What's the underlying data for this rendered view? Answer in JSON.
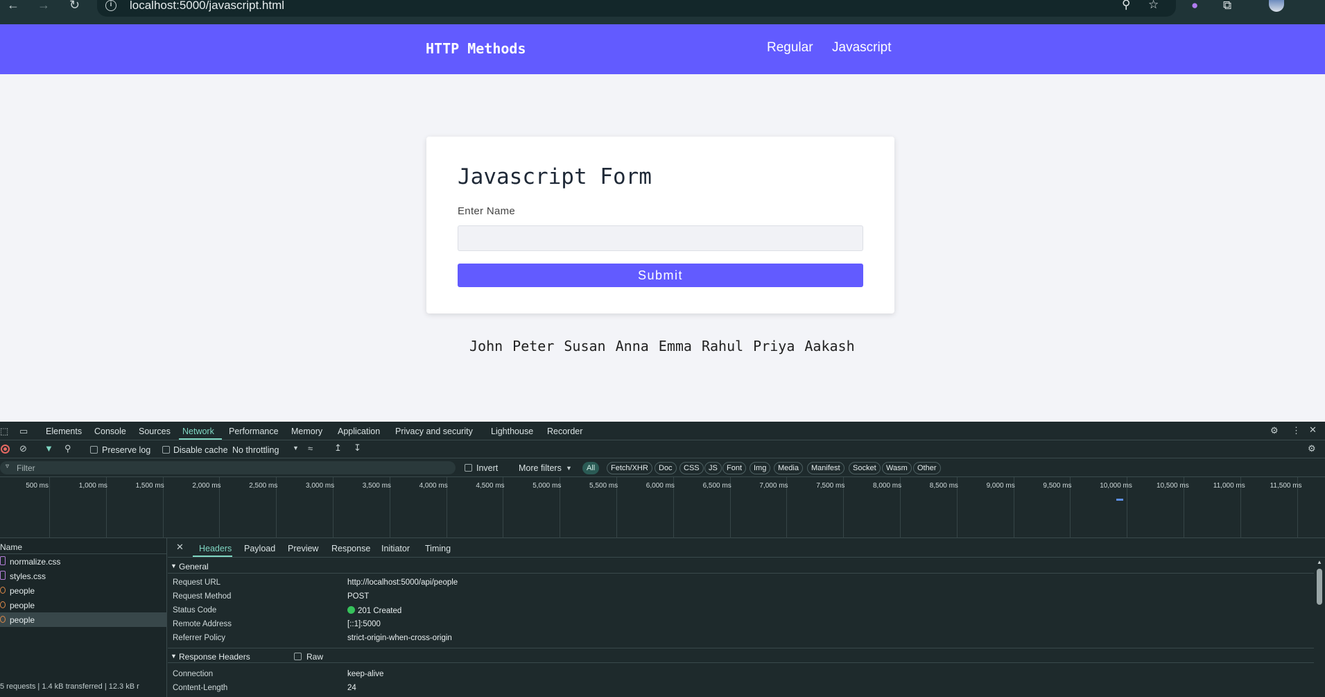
{
  "browser": {
    "url": "localhost:5000/javascript.html"
  },
  "header": {
    "brand": "HTTP Methods",
    "nav": [
      "Regular",
      "Javascript"
    ]
  },
  "form": {
    "title": "Javascript Form",
    "label": "Enter Name",
    "input_value": "",
    "submit_label": "Submit"
  },
  "names": [
    "John",
    "Peter",
    "Susan",
    "Anna",
    "Emma",
    "Rahul",
    "Priya",
    "Aakash"
  ],
  "devtools": {
    "tabs": [
      "Elements",
      "Console",
      "Sources",
      "Network",
      "Performance",
      "Memory",
      "Application",
      "Privacy and security",
      "Lighthouse",
      "Recorder"
    ],
    "active_tab": "Network",
    "toolbar": {
      "preserve_log": "Preserve log",
      "disable_cache": "Disable cache",
      "throttling": "No throttling"
    },
    "filter": {
      "placeholder": "Filter",
      "invert": "Invert",
      "more_filters": "More filters",
      "types": [
        "All",
        "Fetch/XHR",
        "Doc",
        "CSS",
        "JS",
        "Font",
        "Img",
        "Media",
        "Manifest",
        "Socket",
        "Wasm",
        "Other"
      ],
      "active_type": "All"
    },
    "timeline_ticks": [
      "500 ms",
      "1,000 ms",
      "1,500 ms",
      "2,000 ms",
      "2,500 ms",
      "3,000 ms",
      "3,500 ms",
      "4,000 ms",
      "4,500 ms",
      "5,000 ms",
      "5,500 ms",
      "6,000 ms",
      "6,500 ms",
      "7,000 ms",
      "7,500 ms",
      "8,000 ms",
      "8,500 ms",
      "9,000 ms",
      "9,500 ms",
      "10,000 ms",
      "10,500 ms",
      "11,000 ms",
      "11,500 ms"
    ],
    "requests": {
      "column": "Name",
      "items": [
        "normalize.css",
        "styles.css",
        "people",
        "people",
        "people"
      ],
      "footer": "5 requests | 1.4 kB transferred | 12.3 kB r"
    },
    "detail": {
      "tabs": [
        "Headers",
        "Payload",
        "Preview",
        "Response",
        "Initiator",
        "Timing"
      ],
      "general_title": "General",
      "general": [
        {
          "key": "Request URL",
          "value": "http://localhost:5000/api/people"
        },
        {
          "key": "Request Method",
          "value": "POST"
        },
        {
          "key": "Status Code",
          "value": "201 Created"
        },
        {
          "key": "Remote Address",
          "value": "[::1]:5000"
        },
        {
          "key": "Referrer Policy",
          "value": "strict-origin-when-cross-origin"
        }
      ],
      "response_headers_title": "Response Headers",
      "raw_label": "Raw",
      "response_headers": [
        {
          "key": "Connection",
          "value": "keep-alive"
        },
        {
          "key": "Content-Length",
          "value": "24"
        }
      ]
    }
  },
  "colors": {
    "accent": "#625bff",
    "devtools_bg": "#1e2a2c",
    "devtools_active": "#7fd6c2",
    "status_ok": "#36c25b"
  }
}
